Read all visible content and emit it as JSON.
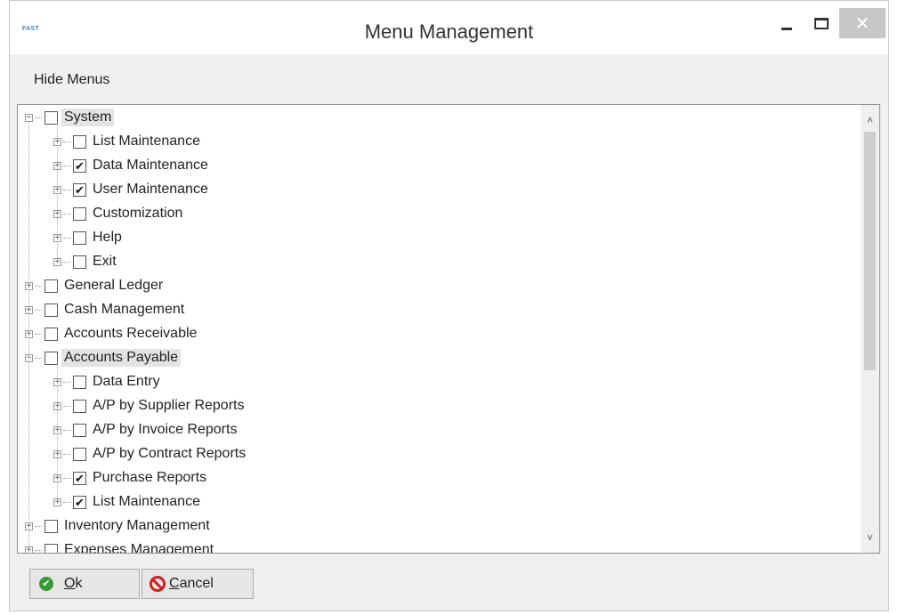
{
  "window": {
    "title": "Menu Management",
    "app_icon_text": "FAST",
    "close_glyph": "✕"
  },
  "menubar": {
    "hide_menus": "Hide Menus"
  },
  "tree": {
    "expand_glyph": "+",
    "collapse_glyph": "−",
    "check_glyph": "✔",
    "nodes": [
      {
        "label": "System",
        "level": 0,
        "expanded": true,
        "checked": false,
        "selected": true
      },
      {
        "label": "List Maintenance",
        "level": 1,
        "expanded": false,
        "checked": false,
        "selected": false
      },
      {
        "label": "Data Maintenance",
        "level": 1,
        "expanded": false,
        "checked": true,
        "selected": false
      },
      {
        "label": "User Maintenance",
        "level": 1,
        "expanded": false,
        "checked": true,
        "selected": false
      },
      {
        "label": "Customization",
        "level": 1,
        "expanded": false,
        "checked": false,
        "selected": false
      },
      {
        "label": "Help",
        "level": 1,
        "expanded": false,
        "checked": false,
        "selected": false
      },
      {
        "label": "Exit",
        "level": 1,
        "expanded": false,
        "checked": false,
        "selected": false
      },
      {
        "label": "General Ledger",
        "level": 0,
        "expanded": false,
        "checked": false,
        "selected": false
      },
      {
        "label": "Cash Management",
        "level": 0,
        "expanded": false,
        "checked": false,
        "selected": false
      },
      {
        "label": "Accounts Receivable",
        "level": 0,
        "expanded": false,
        "checked": false,
        "selected": false
      },
      {
        "label": "Accounts Payable",
        "level": 0,
        "expanded": true,
        "checked": false,
        "selected": true
      },
      {
        "label": "Data Entry",
        "level": 1,
        "expanded": false,
        "checked": false,
        "selected": false
      },
      {
        "label": "A/P by Supplier Reports",
        "level": 1,
        "expanded": false,
        "checked": false,
        "selected": false
      },
      {
        "label": "A/P by Invoice Reports",
        "level": 1,
        "expanded": false,
        "checked": false,
        "selected": false
      },
      {
        "label": "A/P by Contract Reports",
        "level": 1,
        "expanded": false,
        "checked": false,
        "selected": false
      },
      {
        "label": "Purchase Reports",
        "level": 1,
        "expanded": false,
        "checked": true,
        "selected": false
      },
      {
        "label": "List Maintenance",
        "level": 1,
        "expanded": false,
        "checked": true,
        "selected": false
      },
      {
        "label": "Inventory Management",
        "level": 0,
        "expanded": false,
        "checked": false,
        "selected": false
      },
      {
        "label": "Expenses Management",
        "level": 0,
        "expanded": false,
        "checked": false,
        "selected": false
      }
    ]
  },
  "scrollbar": {
    "up_glyph": "˄",
    "down_glyph": "˅"
  },
  "buttons": {
    "ok_first": "O",
    "ok_rest": "k",
    "ok_icon": "✔",
    "cancel_first": "C",
    "cancel_rest": "ancel"
  },
  "colors": {
    "check_green": "#3a9a3a",
    "cancel_red": "#d01f1f",
    "selection": "#e3e3e3"
  },
  "icons": [
    "app-icon",
    "minimize-icon",
    "maximize-icon",
    "close-icon",
    "ok-check-icon",
    "cancel-icon"
  ]
}
